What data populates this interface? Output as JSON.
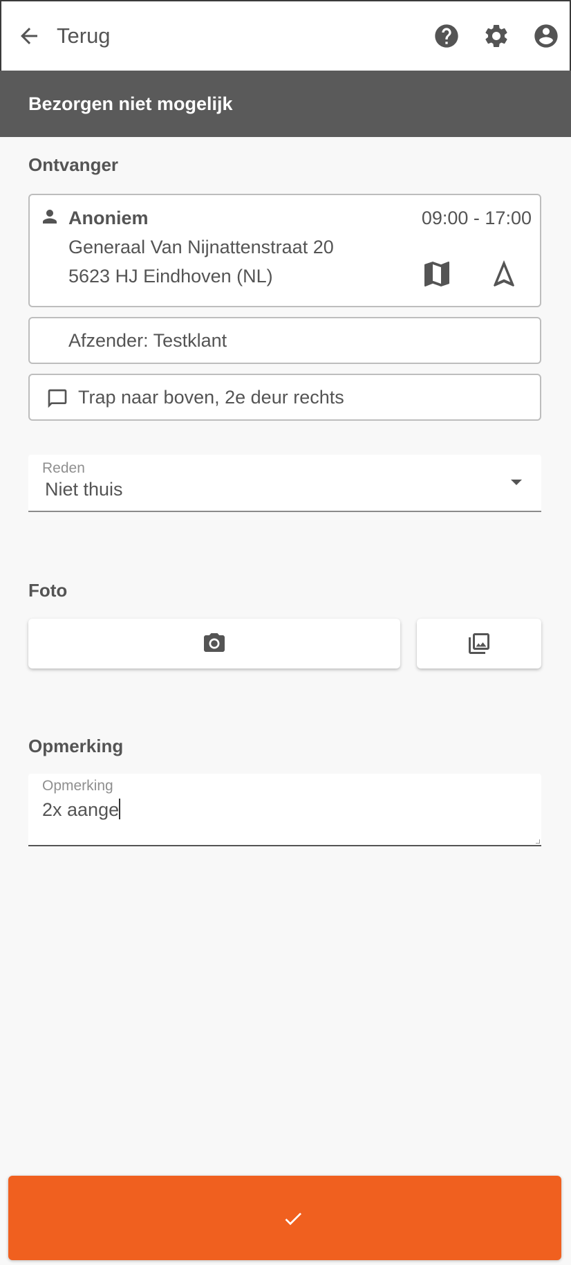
{
  "header": {
    "back_label": "Terug",
    "icons": [
      "arrow-left-icon",
      "help-icon",
      "gear-icon",
      "account-icon"
    ]
  },
  "title": "Bezorgen niet mogelijk",
  "recipient_section": {
    "label": "Ontvanger",
    "name": "Anoniem",
    "time_window": "09:00 - 17:00",
    "address_line1": "Generaal Van Nijnattenstraat 20",
    "address_line2": "5623 HJ Eindhoven (NL)"
  },
  "sender": "Afzender: Testklant",
  "delivery_note": "Trap naar boven, 2e deur rechts",
  "reason": {
    "label": "Reden",
    "value": "Niet thuis"
  },
  "photo_section": {
    "label": "Foto"
  },
  "remark_section": {
    "label": "Opmerking",
    "field_label": "Opmerking",
    "value": "2x aange"
  },
  "colors": {
    "accent": "#f0601f",
    "titlebar": "#5a5a5a",
    "text": "#545454",
    "background": "#f8f8f8"
  }
}
